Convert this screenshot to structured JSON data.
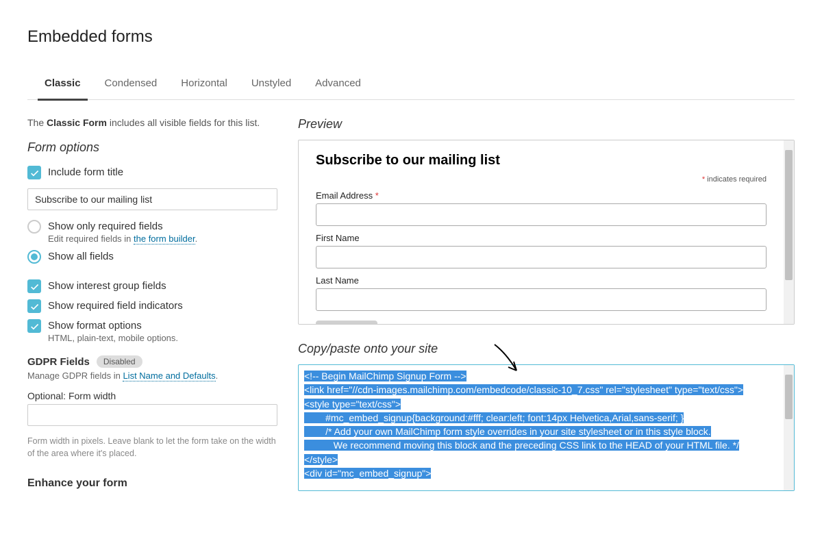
{
  "page_title": "Embedded forms",
  "tabs": [
    "Classic",
    "Condensed",
    "Horizontal",
    "Unstyled",
    "Advanced"
  ],
  "active_tab": 0,
  "intro_prefix": "The ",
  "intro_bold": "Classic Form",
  "intro_suffix": " includes all visible fields for this list.",
  "form_options_heading": "Form options",
  "options": {
    "include_title_label": "Include form title",
    "title_value": "Subscribe to our mailing list",
    "show_required_label": "Show only required fields",
    "show_required_sub_pre": "Edit required fields in ",
    "show_required_sub_link": "the form builder",
    "show_all_label": "Show all fields",
    "interest_groups_label": "Show interest group fields",
    "required_indicators_label": "Show required field indicators",
    "format_options_label": "Show format options",
    "format_options_sub": "HTML, plain-text, mobile options."
  },
  "gdpr": {
    "label": "GDPR Fields",
    "badge": "Disabled",
    "manage_pre": "Manage GDPR fields in ",
    "manage_link": "List Name and Defaults"
  },
  "form_width": {
    "label_pre": "Optional: ",
    "label": "Form width",
    "help": "Form width in pixels. Leave blank to let the form take on the width of the area where it's placed."
  },
  "enhance_heading": "Enhance your form",
  "preview_heading": "Preview",
  "preview": {
    "title": "Subscribe to our mailing list",
    "required_hint_ast": "*",
    "required_hint": " indicates required",
    "email_label": "Email Address ",
    "first_name_label": "First Name",
    "last_name_label": "Last Name"
  },
  "copy_heading": "Copy/paste onto your site",
  "code_lines": [
    "<!-- Begin MailChimp Signup Form -->",
    "<link href=\"//cdn-images.mailchimp.com/embedcode/classic-10_7.css\" rel=\"stylesheet\" type=\"text/css\">",
    "<style type=\"text/css\">",
    "        #mc_embed_signup{background:#fff; clear:left; font:14px Helvetica,Arial,sans-serif; }",
    "        /* Add your own MailChimp form style overrides in your site stylesheet or in this style block.",
    "           We recommend moving this block and the preceding CSS link to the HEAD of your HTML file. */",
    "</style>",
    "<div id=\"mc_embed_signup\">"
  ]
}
